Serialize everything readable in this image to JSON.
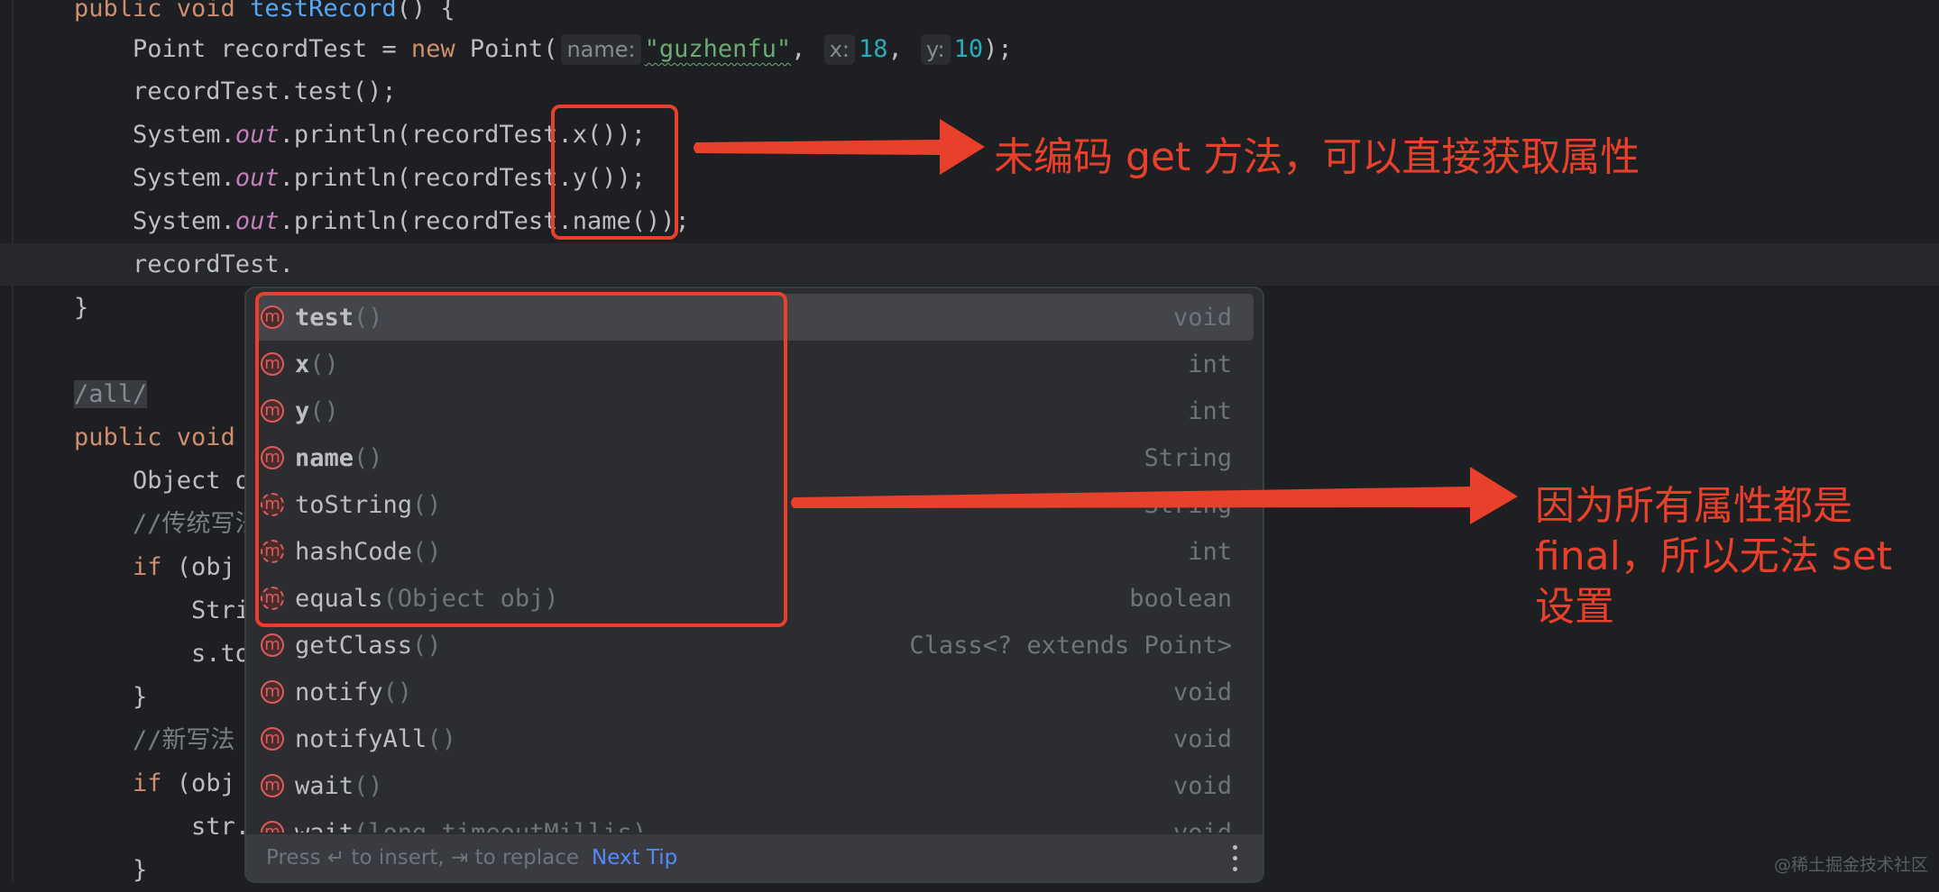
{
  "editor": {
    "lines": {
      "l0": {
        "kw": "public void ",
        "fn": "testRecord",
        "rest": "() {"
      },
      "l1": {
        "pre": "    Point recordTest = ",
        "kw": "new",
        "mid": " Point(",
        "hint_name": "name:",
        "str": "\"guzhenfu\"",
        "comma1": ",",
        "hint_x": "x:",
        "num_x": "18",
        "comma2": ",",
        "hint_y": "y:",
        "num_y": "10",
        "end": ");"
      },
      "l2": {
        "text": "    recordTest.test();"
      },
      "l3": {
        "pre": "    System.",
        "static": "out",
        "post": ".println(recordTest.x());"
      },
      "l4": {
        "pre": "    System.",
        "static": "out",
        "post": ".println(recordTest.y());"
      },
      "l5": {
        "pre": "    System.",
        "static": "out",
        "post": ".println(recordTest.name());"
      },
      "l6": {
        "text": "    recordTest."
      },
      "l7": {
        "text": "}"
      },
      "l9": {
        "text": "/all/"
      },
      "l10": {
        "kw": "public void"
      },
      "l11": {
        "text": "    Object o"
      },
      "l12": {
        "cmt": "    //传统写法"
      },
      "l13": {
        "kw": "    if",
        "rest": " (obj"
      },
      "l14": {
        "text": "        Stri"
      },
      "l15": {
        "text": "        s.to"
      },
      "l16": {
        "text": "    }"
      },
      "l17": {
        "cmt": "    //新写法"
      },
      "l18": {
        "kw": "    if",
        "rest": " (obj"
      },
      "l19": {
        "text": "        str."
      },
      "l20": {
        "text": "    }"
      }
    }
  },
  "completion": {
    "items": [
      {
        "icon": "m",
        "name": "test",
        "params": "()",
        "type": "void",
        "selected": true,
        "bold": true
      },
      {
        "icon": "m",
        "name": "x",
        "params": "()",
        "type": "int",
        "bold": true
      },
      {
        "icon": "m",
        "name": "y",
        "params": "()",
        "type": "int",
        "bold": true
      },
      {
        "icon": "m",
        "name": "name",
        "params": "()",
        "type": "String",
        "bold": true
      },
      {
        "icon": "m",
        "name": "toString",
        "params": "()",
        "type": "String",
        "override": true
      },
      {
        "icon": "m",
        "name": "hashCode",
        "params": "()",
        "type": "int",
        "override": true
      },
      {
        "icon": "m",
        "name": "equals",
        "params": "(Object obj)",
        "type": "boolean",
        "override": true
      },
      {
        "icon": "m",
        "name": "getClass",
        "params": "()",
        "type": "Class<? extends Point>"
      },
      {
        "icon": "m",
        "name": "notify",
        "params": "()",
        "type": "void"
      },
      {
        "icon": "m",
        "name": "notifyAll",
        "params": "()",
        "type": "void"
      },
      {
        "icon": "m",
        "name": "wait",
        "params": "()",
        "type": "void"
      },
      {
        "icon": "m",
        "name": "wait",
        "params": "(long timeoutMillis)",
        "type": "void"
      }
    ],
    "footer": {
      "hint": "Press ↵ to insert, ⇥ to replace",
      "next_tip": "Next Tip"
    }
  },
  "annotations": {
    "text1": "未编码 get 方法，可以直接获取属性",
    "text2": "因为所有属性都是final，所以无法 set 设置",
    "color": "#e8402a"
  },
  "watermark": "@稀土掘金技术社区"
}
